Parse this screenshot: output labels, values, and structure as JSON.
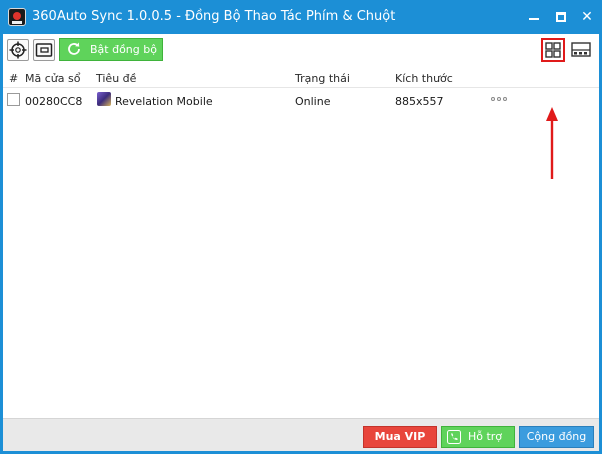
{
  "window": {
    "title": "360Auto Sync 1.0.0.5 - Đồng Bộ Thao Tác Phím & Chuột",
    "minimize_icon": "minimize-icon",
    "maximize_icon": "maximize-icon",
    "close_label": "✕"
  },
  "toolbar": {
    "crosshair_icon": "crosshair-icon",
    "window_icon": "window-icon",
    "sync_label": "Bật đồng bộ",
    "sync_icon": "refresh-icon",
    "grid_view_icon": "grid-view-icon",
    "list_view_icon": "layout-view-icon"
  },
  "table": {
    "columns": [
      "#",
      "Mã cửa sổ",
      "Tiêu đề",
      "Trạng thái",
      "Kích thước"
    ],
    "rows": [
      {
        "id": "00280CC8",
        "title": "Revelation Mobile",
        "status": "Online",
        "size": "885x557",
        "checked": false
      }
    ]
  },
  "footer": {
    "vip_label": "Mua VIP",
    "support_label": "Hỗ trợ",
    "community_label": "Cộng đồng"
  },
  "colors": {
    "titlebar": "#1c8fd6",
    "sync_button": "#5fd35b",
    "vip_button": "#e8453b",
    "support_button": "#5fd35b",
    "community_button": "#3b9cde",
    "highlight": "#e01a1a"
  }
}
